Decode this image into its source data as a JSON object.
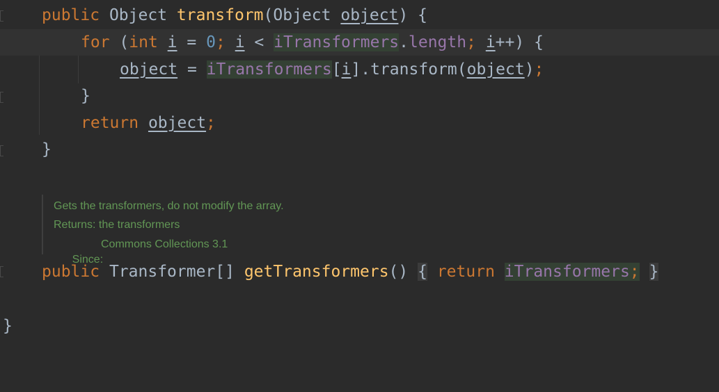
{
  "code": {
    "line1": {
      "kw_public": "public",
      "type_object": "Object",
      "method_transform": "transform",
      "paren_open": "(",
      "param_type": "Object",
      "param_name": "object",
      "paren_close": ")",
      "brace_open": "{"
    },
    "line2": {
      "kw_for": "for",
      "paren_open": "(",
      "kw_int": "int",
      "var_i": "i",
      "op_assign": "=",
      "num_zero": "0",
      "semi1": ";",
      "var_i2": "i",
      "op_lt": "<",
      "field_itransformers": "iTransformers",
      "dot": ".",
      "field_length": "length",
      "semi2": ";",
      "var_i3": "i",
      "op_inc": "++)",
      "brace_open": "{"
    },
    "line3": {
      "var_object": "object",
      "op_assign": "=",
      "field_itransformers": "iTransformers",
      "bracket_open": "[",
      "var_i": "i",
      "bracket_close": "]",
      "call_transform": ".transform(",
      "arg_object": "object",
      "call_close": ")",
      "semi": ";"
    },
    "line4": {
      "brace_close": "}"
    },
    "line5": {
      "kw_return": "return",
      "var_object": "object",
      "semi": ";"
    },
    "line6": {
      "brace_close": "}"
    },
    "line7": {
      "kw_public": "public",
      "type_transformer": "Transformer[]",
      "method_get": "getTransformers",
      "parens": "()",
      "brace_open": "{",
      "kw_return": "return",
      "field_itransformers": "iTransformers",
      "semi": ";",
      "brace_close": "}"
    },
    "line8": {
      "brace_close": "}"
    }
  },
  "javadoc": {
    "description": "Gets the transformers, do not modify the array.",
    "returns": "Returns: the transformers",
    "since_label": "Since:",
    "since_value": "Commons Collections 3.1"
  },
  "colors": {
    "background": "#2b2b2b",
    "keyword": "#cc7832",
    "method": "#ffc66d",
    "field": "#9876aa",
    "number": "#6897bb",
    "text": "#a9b7c6",
    "doc_comment": "#629755"
  }
}
